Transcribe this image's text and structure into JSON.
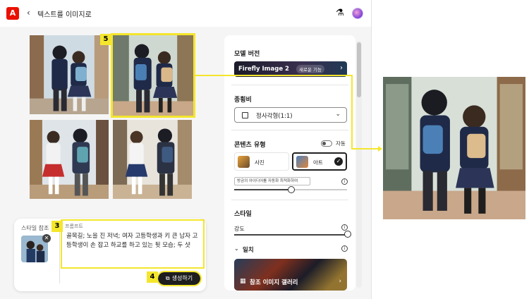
{
  "app": {
    "logo": "A",
    "back_icon": "chevron-left-icon",
    "title": "텍스트를 이미지로",
    "lab_icon": "flask-icon",
    "avatar_icon": "user-avatar"
  },
  "badges": {
    "b5": "5",
    "b3": "3",
    "b4": "4"
  },
  "prompt_card": {
    "style_ref_label": "스타일 참조",
    "prompt_label": "프롬프트",
    "prompt_text": "골목길; 노을 진 저녁; 여자 고등학생과 키 큰 남자 고등학생이 손 잡고 하교를 하고 있는 뒷 모습; 두 샷",
    "generate_label": "생성하기",
    "generate_icon": "external-link-icon",
    "remove_icon": "close-icon"
  },
  "panel": {
    "model_version_label": "모델 버전",
    "model_name": "Firefly Image 2",
    "model_tag": "새로운 기능",
    "model_arrow": "›",
    "aspect_label": "종횡비",
    "aspect_value": "정사각형(1:1)",
    "aspect_chevron": "⌄",
    "content_type_label": "콘텐츠 유형",
    "auto_label": "자동",
    "photo_label": "사진",
    "art_label": "아트",
    "tooltip": "방금의 아이디어를 자동화 최적화하여",
    "style_label": "스타일",
    "strength_label": "강도",
    "match_label": "일치",
    "gallery_label": "참조 이미지 갤러리",
    "gallery_icon": "grid-icon",
    "gallery_arrow": "›",
    "check_icon": "checkmark-icon",
    "info_icon": "info-icon"
  },
  "colors": {
    "highlight": "#f4e62c",
    "brand": "#eb1000",
    "button": "#1e1e1e"
  }
}
